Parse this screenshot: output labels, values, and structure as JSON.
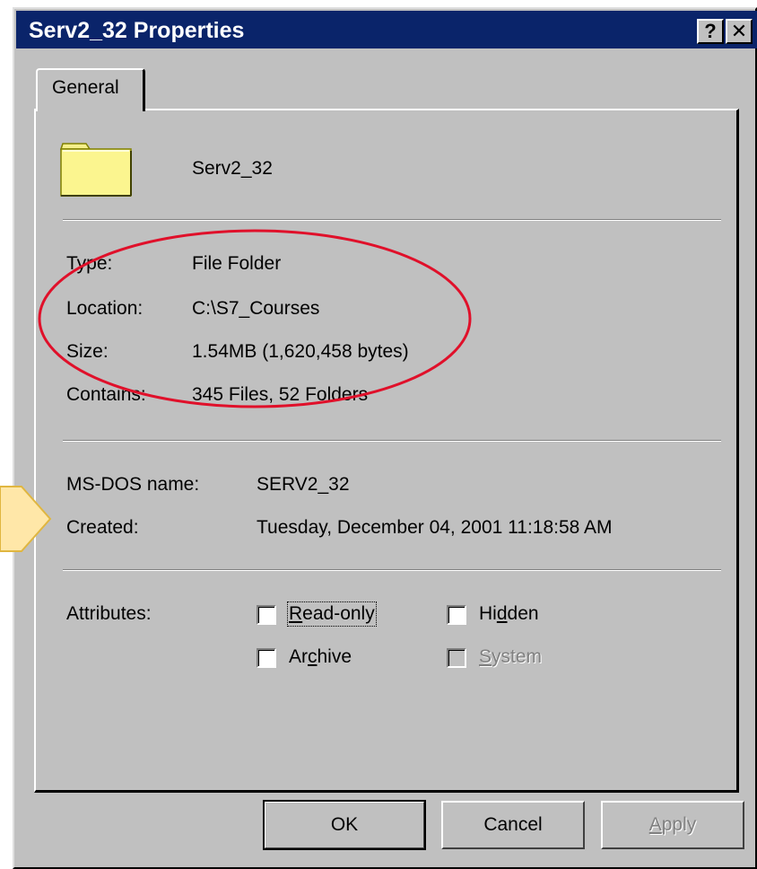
{
  "window": {
    "title": "Serv2_32 Properties",
    "help_button": "?",
    "close_button": "✕"
  },
  "tabs": [
    {
      "label": "General",
      "active": true
    }
  ],
  "folder": {
    "icon": "folder-icon",
    "name": "Serv2_32"
  },
  "details": {
    "type_label": "Type:",
    "type_value": "File Folder",
    "location_label": "Location:",
    "location_value": "C:\\S7_Courses",
    "size_label": "Size:",
    "size_value": "1.54MB (1,620,458 bytes)",
    "contains_label": "Contains:",
    "contains_value": "345 Files, 52 Folders"
  },
  "dos": {
    "msdos_label": "MS-DOS name:",
    "msdos_value": "SERV2_32",
    "created_label": "Created:",
    "created_value": "Tuesday, December 04, 2001 11:18:58 AM"
  },
  "attributes": {
    "label": "Attributes:",
    "readonly": {
      "label_pre": "",
      "label_u": "R",
      "label_post": "ead-only",
      "checked": false
    },
    "hidden": {
      "label_pre": "Hi",
      "label_u": "d",
      "label_post": "den",
      "checked": false
    },
    "archive": {
      "label_pre": "Ar",
      "label_u": "c",
      "label_post": "hive",
      "checked": false
    },
    "system": {
      "label_pre": "",
      "label_u": "S",
      "label_post": "ystem",
      "checked": false,
      "disabled": true
    }
  },
  "buttons": {
    "ok": "OK",
    "cancel": "Cancel",
    "apply": {
      "pre": "",
      "u": "A",
      "post": "pply",
      "disabled": true
    }
  },
  "colors": {
    "titlebar": "#0a246a",
    "face": "#c0c0c0",
    "annotation_ellipse": "#e0102a",
    "annotation_arrow": "#ffe7a8"
  }
}
